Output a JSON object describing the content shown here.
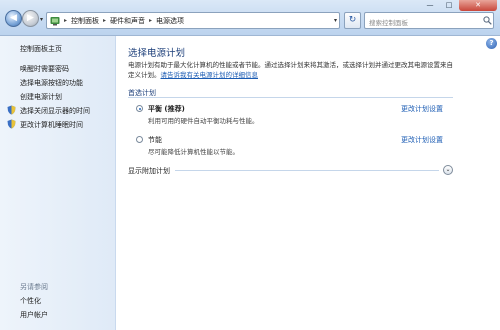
{
  "window": {
    "minimize": "—",
    "maximize": "□",
    "close": "✕"
  },
  "nav": {
    "back": "◀",
    "forward": "▶",
    "recent": "▾",
    "refresh": "↻"
  },
  "address": {
    "breadcrumbs": [
      "控制面板",
      "硬件和声音",
      "电源选项"
    ],
    "separator": "▸",
    "dropdown": "▾"
  },
  "search": {
    "placeholder": "搜索控制面板"
  },
  "sidebar": {
    "home": "控制面板主页",
    "links": [
      {
        "label": "唤醒时需要密码",
        "icon": ""
      },
      {
        "label": "选择电源按钮的功能",
        "icon": ""
      },
      {
        "label": "创建电源计划",
        "icon": ""
      },
      {
        "label": "选择关闭显示器的时间",
        "icon": "shield-icon"
      },
      {
        "label": "更改计算机睡眠时间",
        "icon": "shield-icon"
      }
    ],
    "see_also_title": "另请参阅",
    "see_also": [
      "个性化",
      "用户帐户"
    ]
  },
  "main": {
    "help": "?",
    "title": "选择电源计划",
    "description": "电源计划有助于最大化计算机的性能或者节能。通过选择计划来将其激活，或选择计划并通过更改其电源设置来自定义计划。",
    "description_link": "请告诉我有关电源计划的详细信息",
    "section_title": "首选计划",
    "plans": [
      {
        "name": "平衡 (推荐)",
        "desc": "利用可用的硬件自动平衡功耗与性能。",
        "link": "更改计划设置",
        "selected": true
      },
      {
        "name": "节能",
        "desc": "尽可能降低计算机性能以节能。",
        "link": "更改计划设置",
        "selected": false
      }
    ],
    "more_plans": "显示附加计划",
    "expand": "⌄"
  },
  "colors": {
    "accent_title": "#1d3f7a",
    "link": "#1a5bb3",
    "sidebar_bg": "#e6eff9"
  }
}
